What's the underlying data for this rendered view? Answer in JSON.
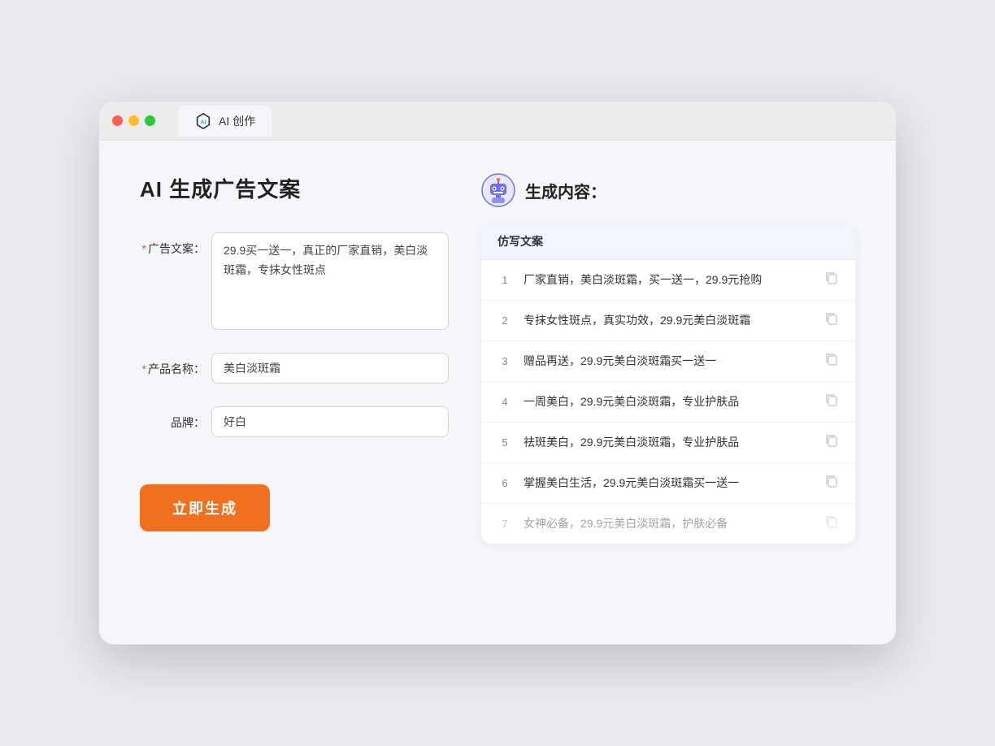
{
  "browser": {
    "tab_label": "AI 创作"
  },
  "page": {
    "title": "AI 生成广告文案",
    "result_title": "生成内容："
  },
  "form": {
    "ad_copy_label": "广告文案：",
    "ad_copy_required": true,
    "ad_copy_value": "29.9买一送一，真正的厂家直销，美白淡斑霜，专抹女性斑点",
    "product_name_label": "产品名称：",
    "product_name_required": true,
    "product_name_value": "美白淡斑霜",
    "brand_label": "品牌：",
    "brand_required": false,
    "brand_value": "好白",
    "generate_button": "立即生成"
  },
  "results": {
    "table_header": "仿写文案",
    "rows": [
      {
        "number": "1",
        "text": "厂家直销，美白淡斑霜，买一送一，29.9元抢购",
        "dimmed": false
      },
      {
        "number": "2",
        "text": "专抹女性斑点，真实功效，29.9元美白淡斑霜",
        "dimmed": false
      },
      {
        "number": "3",
        "text": "赠品再送，29.9元美白淡斑霜买一送一",
        "dimmed": false
      },
      {
        "number": "4",
        "text": "一周美白，29.9元美白淡斑霜，专业护肤品",
        "dimmed": false
      },
      {
        "number": "5",
        "text": "祛斑美白，29.9元美白淡斑霜，专业护肤品",
        "dimmed": false
      },
      {
        "number": "6",
        "text": "掌握美白生活，29.9元美白淡斑霜买一送一",
        "dimmed": false
      },
      {
        "number": "7",
        "text": "女神必备，29.9元美白淡斑霜，护肤必备",
        "dimmed": true
      }
    ]
  },
  "colors": {
    "accent": "#f07020",
    "primary_blue": "#5a8dee"
  }
}
